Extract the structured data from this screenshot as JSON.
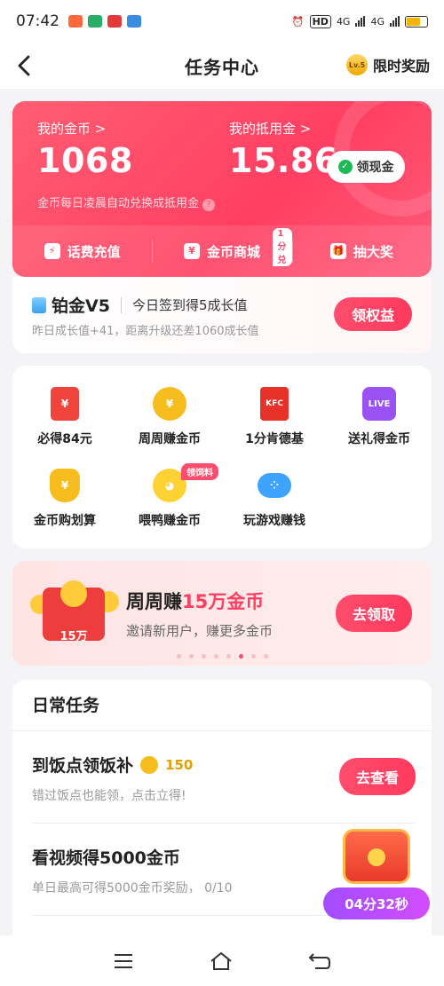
{
  "status_bar": {
    "time": "07:42",
    "net1": "4G",
    "net2": "4G"
  },
  "nav": {
    "title": "任务中心",
    "level_badge": "Lv.5",
    "reward_label": "限时奖励"
  },
  "wallet": {
    "coins_label": "我的金币 >",
    "coins_value": "1068",
    "deduct_label": "我的抵用金 >",
    "deduct_value": "15.86",
    "cash_button": "领现金",
    "hint": "金币每日凌晨自动兑换成抵用金",
    "shortcuts": [
      {
        "label": "话费充值",
        "icon": "lightning-icon"
      },
      {
        "label": "金币商城",
        "icon": "coin-mall-icon",
        "badge": "1分兑"
      },
      {
        "label": "抽大奖",
        "icon": "gift-icon"
      }
    ]
  },
  "level": {
    "title": "铂金V5",
    "subtitle": "今日签到得5成长值",
    "desc": "昨日成长值+41，距离升级还差1060成长值",
    "button": "领权益"
  },
  "grid": [
    {
      "label": "必得84元",
      "icon": "red-envelope-icon"
    },
    {
      "label": "周周赚金币",
      "icon": "gold-coin-icon"
    },
    {
      "label": "1分肯德基",
      "icon": "kfc-icon"
    },
    {
      "label": "送礼得金币",
      "icon": "live-icon"
    },
    {
      "label": "金币购划算",
      "icon": "money-bag-icon"
    },
    {
      "label": "喂鸭赚金币",
      "icon": "duck-icon",
      "tag": "领饲料"
    },
    {
      "label": "玩游戏赚钱",
      "icon": "gamepad-icon"
    }
  ],
  "promo": {
    "title_prefix": "周周赚",
    "title_highlight": "15万金币",
    "subtitle": "邀请新用户，赚更多金币",
    "envelope_label": "15万",
    "button": "去领取",
    "active_dot": 5,
    "dot_count": 8
  },
  "daily": {
    "header": "日常任务",
    "tasks": [
      {
        "title": "到饭点领饭补",
        "coins": "150",
        "subtitle": "错过饭点也能领，点击立得!",
        "button": "去查看"
      },
      {
        "title": "看视频得5000金币",
        "subtitle": "单日最高可得5000金币奖励， 0/10"
      }
    ]
  },
  "chest": {
    "timer": "04分32秒"
  }
}
